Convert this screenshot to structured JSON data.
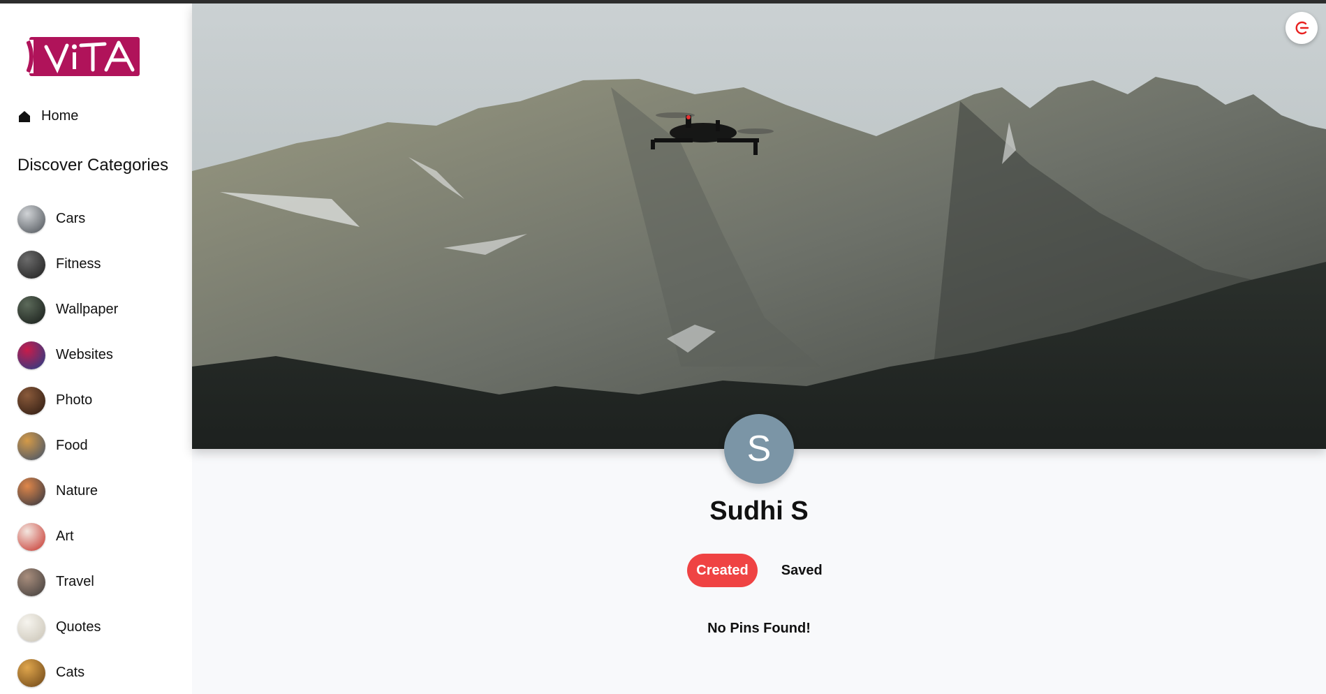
{
  "brand": {
    "logo_text": "VITA",
    "logo_color": "#b0135a"
  },
  "sidebar": {
    "home_label": "Home",
    "categories_heading": "Discover Categories",
    "categories": [
      {
        "label": "Cars",
        "thumb_colors": [
          "#d0d3d6",
          "#4a4f55"
        ]
      },
      {
        "label": "Fitness",
        "thumb_colors": [
          "#6b6b6b",
          "#1c1c1c"
        ]
      },
      {
        "label": "Wallpaper",
        "thumb_colors": [
          "#5c6a5a",
          "#151a17"
        ]
      },
      {
        "label": "Websites",
        "thumb_colors": [
          "#c81c4a",
          "#1d3f8a"
        ]
      },
      {
        "label": "Photo",
        "thumb_colors": [
          "#8a5a3a",
          "#2a1810"
        ]
      },
      {
        "label": "Food",
        "thumb_colors": [
          "#d49a48",
          "#3d4f6a"
        ]
      },
      {
        "label": "Nature",
        "thumb_colors": [
          "#e0874a",
          "#2c3340"
        ]
      },
      {
        "label": "Art",
        "thumb_colors": [
          "#f3e6df",
          "#c5322a"
        ]
      },
      {
        "label": "Travel",
        "thumb_colors": [
          "#a98e7d",
          "#3d3a39"
        ]
      },
      {
        "label": "Quotes",
        "thumb_colors": [
          "#f6f4ee",
          "#c9c3b5"
        ]
      },
      {
        "label": "Cats",
        "thumb_colors": [
          "#e0a64c",
          "#6a4316"
        ]
      }
    ]
  },
  "header": {
    "logout_icon": "google-logout-icon",
    "logout_color": "#e8201f"
  },
  "profile": {
    "avatar_letter": "S",
    "avatar_color": "#7b95a6",
    "name": "Sudhi S",
    "tabs": [
      {
        "label": "Created",
        "active": true
      },
      {
        "label": "Saved",
        "active": false
      }
    ],
    "empty_message": "No Pins Found!"
  },
  "colors": {
    "accent": "#ef4343",
    "page_bg": "#f8f9fb"
  }
}
